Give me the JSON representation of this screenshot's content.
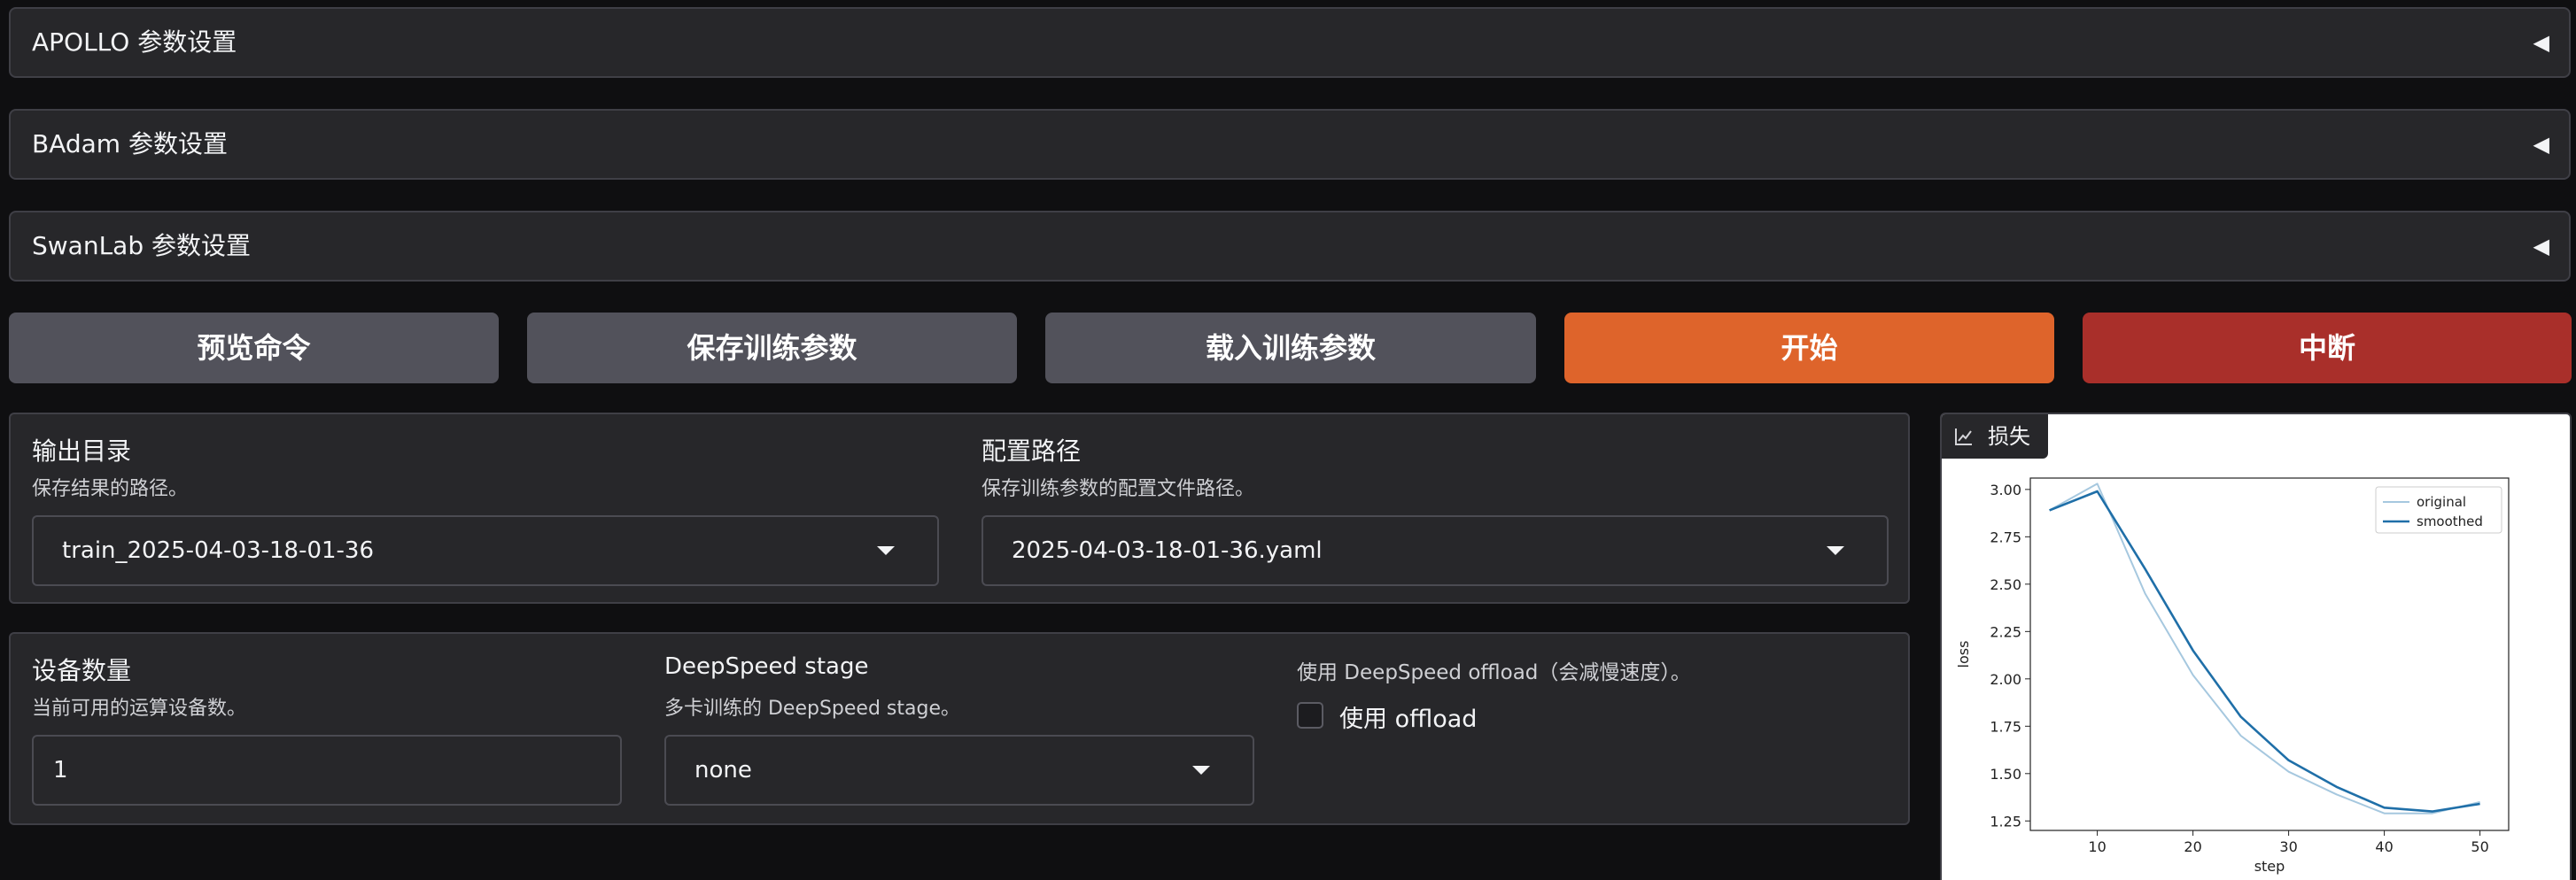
{
  "accordions": [
    {
      "title": "APOLLO 参数设置",
      "arrow": "◀"
    },
    {
      "title": "BAdam 参数设置",
      "arrow": "◀"
    },
    {
      "title": "SwanLab 参数设置",
      "arrow": "◀"
    }
  ],
  "buttons": {
    "preview": "预览命令",
    "save": "保存训练参数",
    "load": "载入训练参数",
    "start": "开始",
    "abort": "中断"
  },
  "output_panel": {
    "output_dir": {
      "label": "输出目录",
      "info": "保存结果的路径。",
      "value": "train_2025-04-03-18-01-36"
    },
    "config_path": {
      "label": "配置路径",
      "info": "保存训练参数的配置文件路径。",
      "value": "2025-04-03-18-01-36.yaml"
    }
  },
  "device_panel": {
    "device_count": {
      "label": "设备数量",
      "info": "当前可用的运算设备数。",
      "value": "1"
    },
    "ds_stage": {
      "label": "DeepSpeed stage",
      "info": "多卡训练的 DeepSpeed stage。",
      "value": "none"
    },
    "ds_offload": {
      "info": "使用 DeepSpeed offload（会减慢速度）。",
      "label": "使用 offload",
      "checked": false
    }
  },
  "plot": {
    "tag_label": "损失",
    "tag_icon": "line-chart-icon"
  },
  "colors": {
    "accent_orange": "#de642b",
    "stop_red": "#a92f2a",
    "secondary_grey": "#52525b",
    "panel_bg": "#27272a",
    "page_bg": "#0f0f11",
    "original_line": "#a6c8df",
    "smoothed_line": "#1f6fa8"
  },
  "chart_data": {
    "type": "line",
    "xlabel": "step",
    "ylabel": "loss",
    "xlim": [
      3,
      53
    ],
    "ylim": [
      1.2,
      3.06
    ],
    "xticks": [
      10,
      20,
      30,
      40,
      50
    ],
    "yticks": [
      1.25,
      1.5,
      1.75,
      2.0,
      2.25,
      2.5,
      2.75,
      3.0
    ],
    "grid": false,
    "legend": "top-right",
    "series": [
      {
        "name": "original",
        "x": [
          5,
          10,
          15,
          20,
          25,
          30,
          35,
          40,
          45,
          50
        ],
        "y": [
          2.89,
          3.03,
          2.45,
          2.02,
          1.7,
          1.51,
          1.39,
          1.29,
          1.29,
          1.35
        ]
      },
      {
        "name": "smoothed",
        "x": [
          5,
          10,
          15,
          20,
          25,
          30,
          35,
          40,
          45,
          50
        ],
        "y": [
          2.89,
          2.99,
          2.58,
          2.15,
          1.8,
          1.57,
          1.43,
          1.32,
          1.3,
          1.34
        ]
      }
    ]
  }
}
